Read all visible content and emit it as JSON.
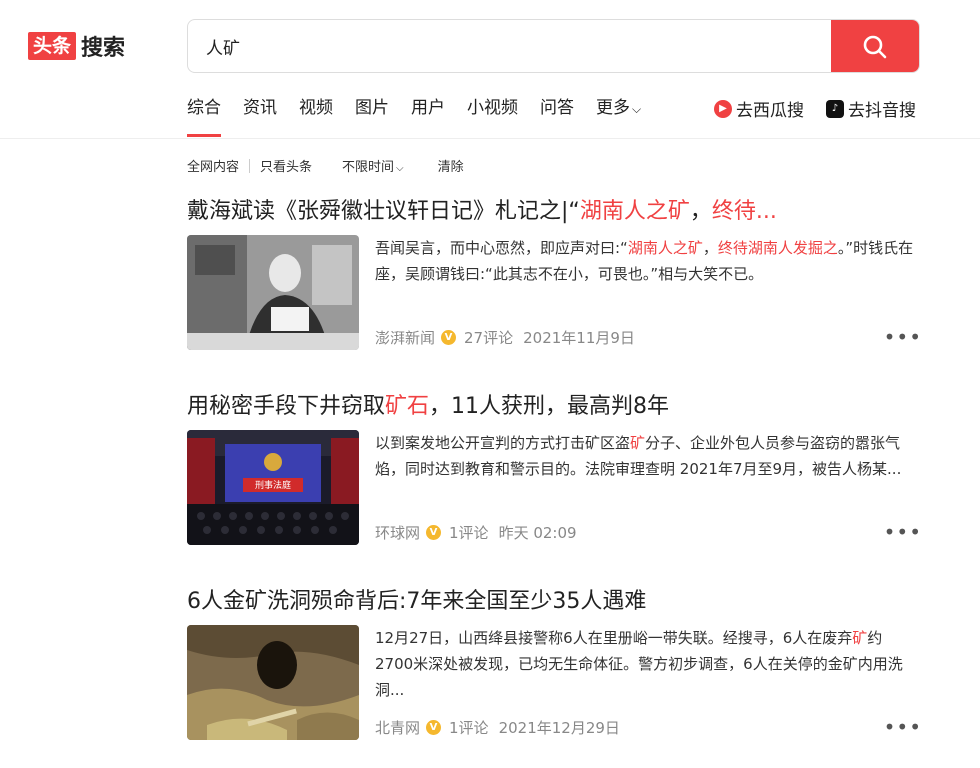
{
  "logo": {
    "box": "头条",
    "text": "搜索"
  },
  "search": {
    "value": "人矿",
    "button_icon": "search-icon"
  },
  "tabs": [
    {
      "label": "综合",
      "active": true
    },
    {
      "label": "资讯"
    },
    {
      "label": "视频"
    },
    {
      "label": "图片"
    },
    {
      "label": "用户"
    },
    {
      "label": "小视频"
    },
    {
      "label": "问答"
    },
    {
      "label": "更多"
    }
  ],
  "external": [
    {
      "label": "去西瓜搜",
      "icon": "xigua-icon",
      "color": "#f04142"
    },
    {
      "label": "去抖音搜",
      "icon": "douyin-icon",
      "color": "#111111"
    }
  ],
  "filters": {
    "all": "全网内容",
    "only": "只看头条",
    "time": "不限时间",
    "clear": "清除"
  },
  "results": [
    {
      "title_parts": [
        "戴海斌读《张舜徽壮议轩日记》札记之|“",
        "湖南人之矿",
        "，",
        "终待..."
      ],
      "snippet_parts": [
        "吾闻吴言，而中心恧然，即应声对曰:“",
        "湖南人之矿",
        "，",
        "终待湖南人发掘之",
        "。”时钱氏在座，吴顾谓钱曰:“此其志不在小，可畏也。”相与大笑不已。"
      ],
      "source": "澎湃新闻",
      "comments": "27评论",
      "time": "2021年11月9日"
    },
    {
      "title_parts": [
        "用秘密手段下井窃取",
        "矿石",
        "，11人获刑，最高判8年"
      ],
      "snippet_parts": [
        "以到案发地公开宣判的方式打击矿区盗",
        "矿",
        "分子、企业外包人员参与盗窃的嚣张气焰，同时达到教育和警示目的。法院审理查明 2021年7月至9月，被告人杨某..."
      ],
      "thumb_text": "刑事法庭",
      "source": "环球网",
      "comments": "1评论",
      "time": "昨天 02:09"
    },
    {
      "title_parts": [
        "6人金矿洗洞殒命背后:7年来全国至少35人遇难"
      ],
      "snippet_parts": [
        "12月27日，山西绛县接警称6人在里册峪一带失联。经搜寻，6人在废弃",
        "矿",
        "约2700米深处被发现，已均无生命体征。警方初步调查，6人在关停的金矿内用洗洞..."
      ],
      "source": "北青网",
      "comments": "1评论",
      "time": "2021年12月29日"
    }
  ],
  "more_label": "•••",
  "verified_mark": "V"
}
